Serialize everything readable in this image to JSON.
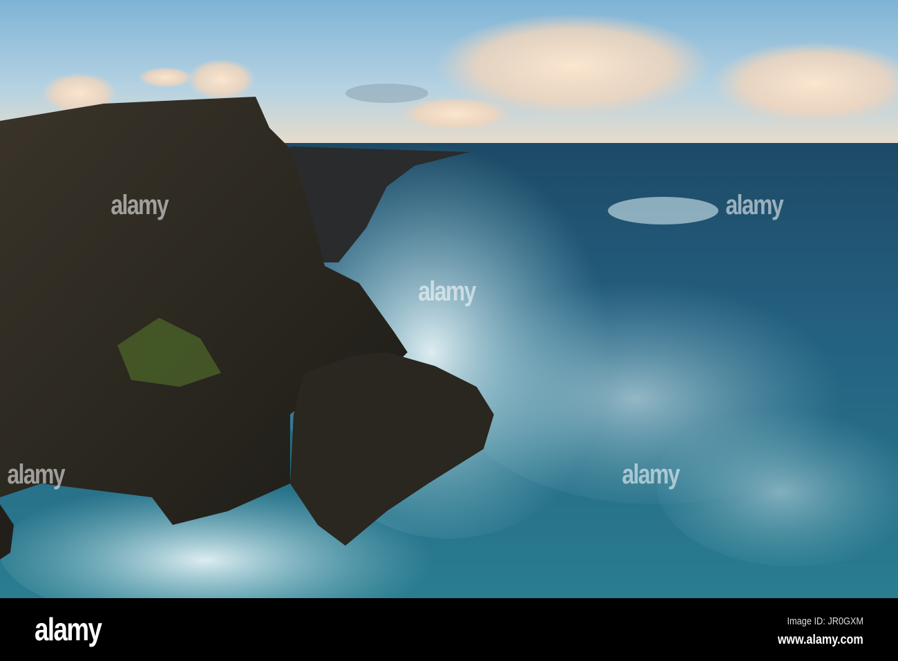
{
  "watermark": {
    "brand": "alamy"
  },
  "footer": {
    "logo": "alamy",
    "image_id": "Image ID: JR0GXM",
    "website": "www.alamy.com"
  },
  "colors": {
    "sky_top": "#7fb3d6",
    "sea": "#1f5a78",
    "foam": "#d8ecf2",
    "cliff": "#2f2a22",
    "footer": "#000000"
  }
}
